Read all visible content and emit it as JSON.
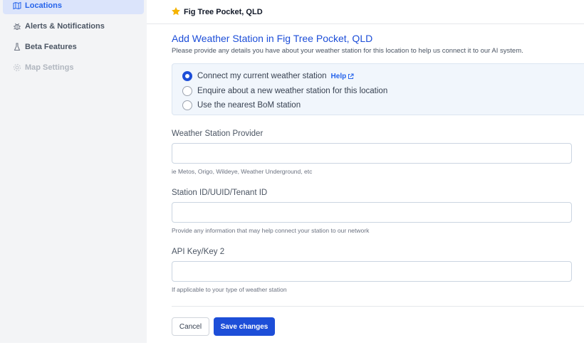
{
  "sidebar": {
    "items": [
      {
        "label": "Locations",
        "icon": "map-icon",
        "state": "active"
      },
      {
        "label": "Alerts & Notifications",
        "icon": "bug-icon",
        "state": "normal"
      },
      {
        "label": "Beta Features",
        "icon": "flask-icon",
        "state": "normal"
      },
      {
        "label": "Map Settings",
        "icon": "gear-icon",
        "state": "disabled"
      }
    ]
  },
  "location": {
    "name": "Fig Tree Pocket, QLD",
    "icon": "star-icon"
  },
  "form": {
    "title": "Add Weather Station in Fig Tree Pocket, QLD",
    "subtitle": "Please provide any details you have about your weather station for this location to help us connect it to our AI system.",
    "options": [
      {
        "label": "Connect my current weather station",
        "checked": true
      },
      {
        "label": "Enquire about a new weather station for this location",
        "checked": false
      },
      {
        "label": "Use the nearest BoM station",
        "checked": false
      }
    ],
    "help_label": "Help",
    "fields": [
      {
        "label": "Weather Station Provider",
        "value": "",
        "hint": "ie Metos, Origo, Wildeye, Weather Underground, etc"
      },
      {
        "label": "Station ID/UUID/Tenant ID",
        "value": "",
        "hint": "Provide any information that may help connect your station to our network"
      },
      {
        "label": "API Key/Key 2",
        "value": "",
        "hint": "If applicable to your type of weather station"
      }
    ],
    "cancel_label": "Cancel",
    "save_label": "Save changes"
  },
  "colors": {
    "accent": "#1d4ed8",
    "sidebar_bg": "#f3f4f6",
    "active_bg": "#dbe4fb",
    "star": "#f5b301"
  }
}
